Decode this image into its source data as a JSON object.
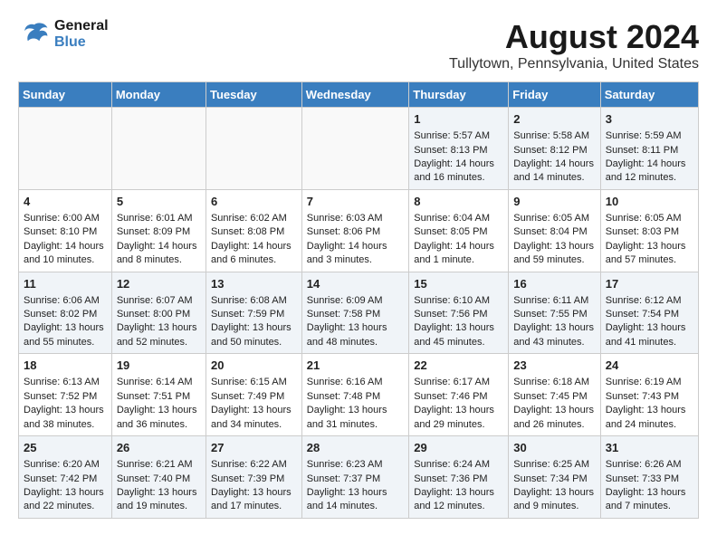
{
  "logo": {
    "line1": "General",
    "line2": "Blue"
  },
  "title": "August 2024",
  "subtitle": "Tullytown, Pennsylvania, United States",
  "weekdays": [
    "Sunday",
    "Monday",
    "Tuesday",
    "Wednesday",
    "Thursday",
    "Friday",
    "Saturday"
  ],
  "weeks": [
    [
      {
        "day": "",
        "content": ""
      },
      {
        "day": "",
        "content": ""
      },
      {
        "day": "",
        "content": ""
      },
      {
        "day": "",
        "content": ""
      },
      {
        "day": "1",
        "content": "Sunrise: 5:57 AM\nSunset: 8:13 PM\nDaylight: 14 hours and 16 minutes."
      },
      {
        "day": "2",
        "content": "Sunrise: 5:58 AM\nSunset: 8:12 PM\nDaylight: 14 hours and 14 minutes."
      },
      {
        "day": "3",
        "content": "Sunrise: 5:59 AM\nSunset: 8:11 PM\nDaylight: 14 hours and 12 minutes."
      }
    ],
    [
      {
        "day": "4",
        "content": "Sunrise: 6:00 AM\nSunset: 8:10 PM\nDaylight: 14 hours and 10 minutes."
      },
      {
        "day": "5",
        "content": "Sunrise: 6:01 AM\nSunset: 8:09 PM\nDaylight: 14 hours and 8 minutes."
      },
      {
        "day": "6",
        "content": "Sunrise: 6:02 AM\nSunset: 8:08 PM\nDaylight: 14 hours and 6 minutes."
      },
      {
        "day": "7",
        "content": "Sunrise: 6:03 AM\nSunset: 8:06 PM\nDaylight: 14 hours and 3 minutes."
      },
      {
        "day": "8",
        "content": "Sunrise: 6:04 AM\nSunset: 8:05 PM\nDaylight: 14 hours and 1 minute."
      },
      {
        "day": "9",
        "content": "Sunrise: 6:05 AM\nSunset: 8:04 PM\nDaylight: 13 hours and 59 minutes."
      },
      {
        "day": "10",
        "content": "Sunrise: 6:05 AM\nSunset: 8:03 PM\nDaylight: 13 hours and 57 minutes."
      }
    ],
    [
      {
        "day": "11",
        "content": "Sunrise: 6:06 AM\nSunset: 8:02 PM\nDaylight: 13 hours and 55 minutes."
      },
      {
        "day": "12",
        "content": "Sunrise: 6:07 AM\nSunset: 8:00 PM\nDaylight: 13 hours and 52 minutes."
      },
      {
        "day": "13",
        "content": "Sunrise: 6:08 AM\nSunset: 7:59 PM\nDaylight: 13 hours and 50 minutes."
      },
      {
        "day": "14",
        "content": "Sunrise: 6:09 AM\nSunset: 7:58 PM\nDaylight: 13 hours and 48 minutes."
      },
      {
        "day": "15",
        "content": "Sunrise: 6:10 AM\nSunset: 7:56 PM\nDaylight: 13 hours and 45 minutes."
      },
      {
        "day": "16",
        "content": "Sunrise: 6:11 AM\nSunset: 7:55 PM\nDaylight: 13 hours and 43 minutes."
      },
      {
        "day": "17",
        "content": "Sunrise: 6:12 AM\nSunset: 7:54 PM\nDaylight: 13 hours and 41 minutes."
      }
    ],
    [
      {
        "day": "18",
        "content": "Sunrise: 6:13 AM\nSunset: 7:52 PM\nDaylight: 13 hours and 38 minutes."
      },
      {
        "day": "19",
        "content": "Sunrise: 6:14 AM\nSunset: 7:51 PM\nDaylight: 13 hours and 36 minutes."
      },
      {
        "day": "20",
        "content": "Sunrise: 6:15 AM\nSunset: 7:49 PM\nDaylight: 13 hours and 34 minutes."
      },
      {
        "day": "21",
        "content": "Sunrise: 6:16 AM\nSunset: 7:48 PM\nDaylight: 13 hours and 31 minutes."
      },
      {
        "day": "22",
        "content": "Sunrise: 6:17 AM\nSunset: 7:46 PM\nDaylight: 13 hours and 29 minutes."
      },
      {
        "day": "23",
        "content": "Sunrise: 6:18 AM\nSunset: 7:45 PM\nDaylight: 13 hours and 26 minutes."
      },
      {
        "day": "24",
        "content": "Sunrise: 6:19 AM\nSunset: 7:43 PM\nDaylight: 13 hours and 24 minutes."
      }
    ],
    [
      {
        "day": "25",
        "content": "Sunrise: 6:20 AM\nSunset: 7:42 PM\nDaylight: 13 hours and 22 minutes."
      },
      {
        "day": "26",
        "content": "Sunrise: 6:21 AM\nSunset: 7:40 PM\nDaylight: 13 hours and 19 minutes."
      },
      {
        "day": "27",
        "content": "Sunrise: 6:22 AM\nSunset: 7:39 PM\nDaylight: 13 hours and 17 minutes."
      },
      {
        "day": "28",
        "content": "Sunrise: 6:23 AM\nSunset: 7:37 PM\nDaylight: 13 hours and 14 minutes."
      },
      {
        "day": "29",
        "content": "Sunrise: 6:24 AM\nSunset: 7:36 PM\nDaylight: 13 hours and 12 minutes."
      },
      {
        "day": "30",
        "content": "Sunrise: 6:25 AM\nSunset: 7:34 PM\nDaylight: 13 hours and 9 minutes."
      },
      {
        "day": "31",
        "content": "Sunrise: 6:26 AM\nSunset: 7:33 PM\nDaylight: 13 hours and 7 minutes."
      }
    ]
  ]
}
